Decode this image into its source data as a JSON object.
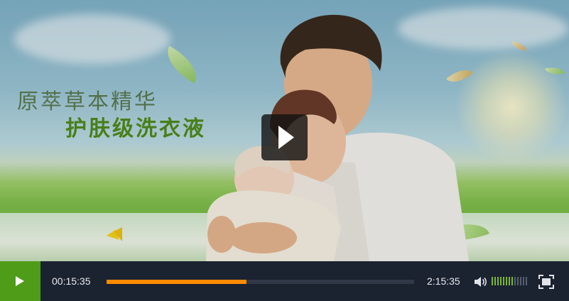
{
  "ad": {
    "headline_1": "原萃草本精华",
    "headline_2": "护肤级洗衣液"
  },
  "controls": {
    "current_time": "00:15:35",
    "duration": "2:15:35",
    "progress_fraction": 0.456,
    "volume_level": 0.62,
    "volume_bar_count": 13
  },
  "icons": {
    "overlay": "play-icon",
    "play": "play-icon",
    "volume": "speaker-icon",
    "fullscreen": "fullscreen-icon"
  },
  "colors": {
    "control_bar": "#1b2230",
    "play_button": "#4f9c18",
    "progress_fill": "#ff8a00",
    "volume_on": "#7ab82c",
    "headline_1": "#5a7a52",
    "headline_2": "#4f8a1c"
  }
}
